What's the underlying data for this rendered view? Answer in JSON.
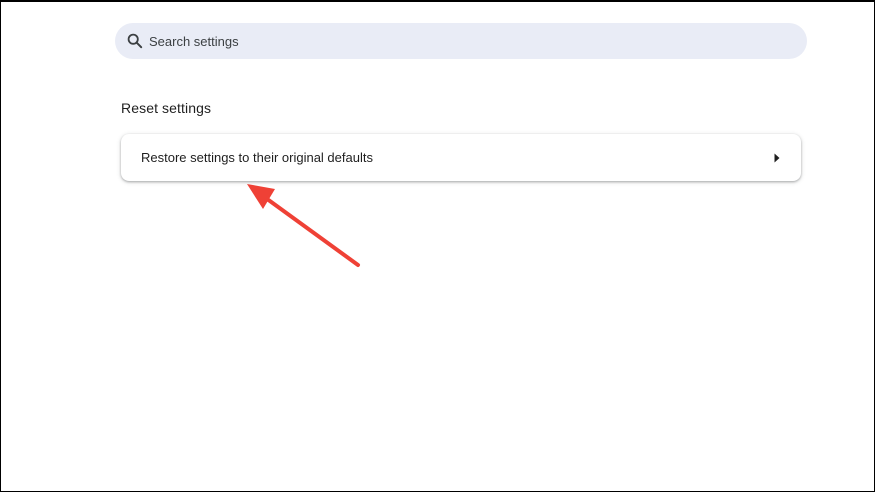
{
  "search": {
    "placeholder": "Search settings",
    "icon": "search-icon"
  },
  "reset_section": {
    "title": "Reset settings",
    "items": [
      {
        "label": "Restore settings to their original defaults",
        "icon": "arrow-right-icon"
      }
    ]
  },
  "colors": {
    "search_background": "#e9ecf6",
    "annotation_arrow": "#ef4136"
  }
}
